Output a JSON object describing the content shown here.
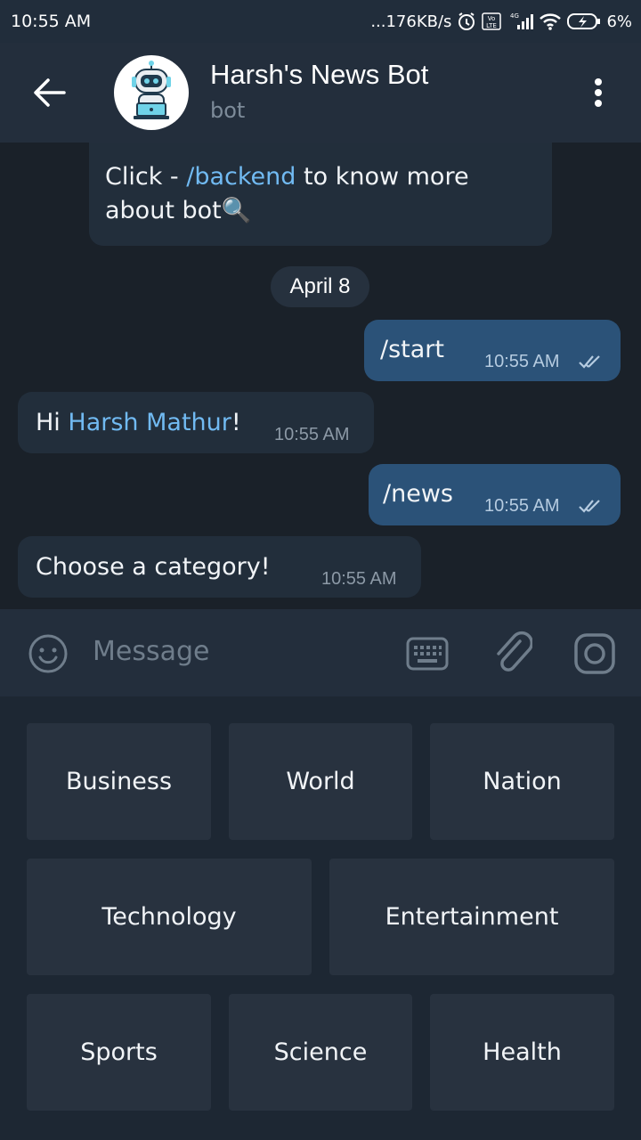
{
  "status_bar": {
    "time": "10:55 AM",
    "network_speed": "...176KB/s",
    "battery": "6%",
    "network_type": "4G",
    "volte": "Vo LTE"
  },
  "header": {
    "title": "Harsh's News Bot",
    "subtitle": "bot"
  },
  "messages": {
    "intro_prefix": "Click - ",
    "intro_link": "/backend",
    "intro_suffix": " to know more about bot🔍",
    "date_separator": "April 8",
    "msg1_text": "/start",
    "msg1_time": "10:55 AM",
    "msg2_prefix": "Hi ",
    "msg2_name": "Harsh Mathur",
    "msg2_suffix": "!",
    "msg2_time": "10:55 AM",
    "msg3_text": "/news",
    "msg3_time": "10:55 AM",
    "msg4_text": "Choose a category!",
    "msg4_time": "10:55 AM"
  },
  "input": {
    "placeholder": "Message"
  },
  "keyboard": {
    "row1": [
      "Business",
      "World",
      "Nation"
    ],
    "row2": [
      "Technology",
      "Entertainment"
    ],
    "row3": [
      "Sports",
      "Science",
      "Health"
    ]
  },
  "colors": {
    "chat_bg": "#1a2129",
    "header_bg": "#232e3c",
    "incoming_bubble": "#222e3b",
    "outgoing_bubble": "#2b5278",
    "link": "#71baf2"
  }
}
